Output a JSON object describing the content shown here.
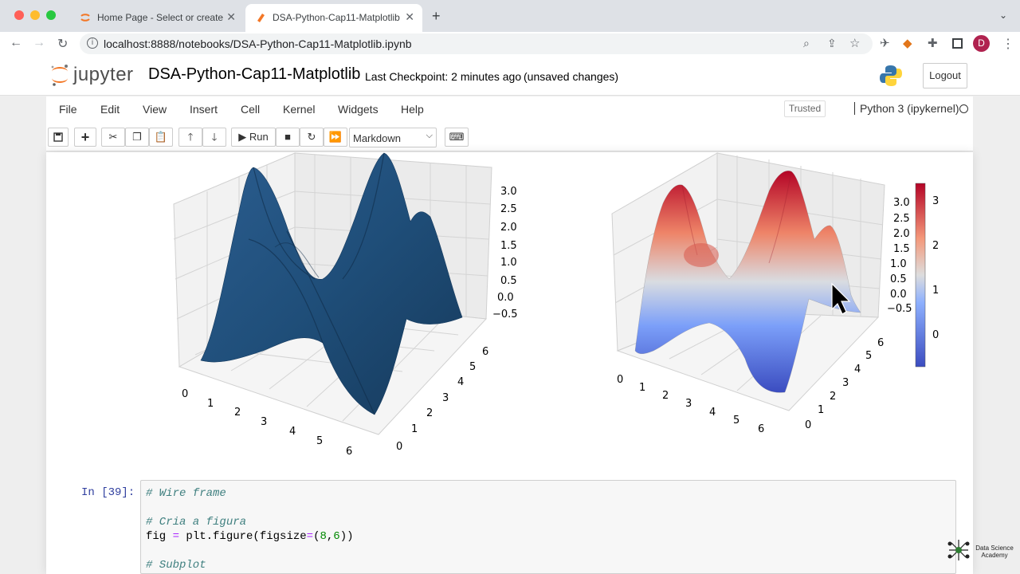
{
  "browser": {
    "tabs": [
      {
        "label": "Home Page - Select or create a notebook"
      },
      {
        "label": "DSA-Python-Cap11-Matplotlib"
      }
    ],
    "url": "localhost:8888/notebooks/DSA-Python-Cap11-Matplotlib.ipynb",
    "profile_initial": "D"
  },
  "jupyter": {
    "logo_text": "jupyter",
    "notebook_name": "DSA-Python-Cap11-Matplotlib",
    "checkpoint": "Last Checkpoint: 2 minutes ago",
    "status": "(unsaved changes)",
    "logout_label": "Logout",
    "menu": [
      "File",
      "Edit",
      "View",
      "Insert",
      "Cell",
      "Kernel",
      "Widgets",
      "Help"
    ],
    "trusted_label": "Trusted",
    "kernel_name": "Python 3 (ipykernel)",
    "toolbar": {
      "run_label": "Run",
      "cell_type": "Markdown"
    }
  },
  "chart_data": [
    {
      "type": "surface3d",
      "z_ticks": [
        "3.0",
        "2.5",
        "2.0",
        "1.5",
        "1.0",
        "0.5",
        "0.0",
        "−0.5"
      ],
      "x_ticks": [
        "0",
        "1",
        "2",
        "3",
        "4",
        "5",
        "6"
      ],
      "y_ticks": [
        "0",
        "1",
        "2",
        "3",
        "4",
        "5",
        "6"
      ],
      "colors": {
        "surface": "#1f4e79"
      }
    },
    {
      "type": "surface3d",
      "colormap": "coolwarm",
      "z_ticks": [
        "3.0",
        "2.5",
        "2.0",
        "1.5",
        "1.0",
        "0.5",
        "0.0",
        "−0.5"
      ],
      "x_ticks": [
        "0",
        "1",
        "2",
        "3",
        "4",
        "5",
        "6"
      ],
      "y_ticks": [
        "0",
        "1",
        "2",
        "3",
        "4",
        "5",
        "6"
      ],
      "colorbar_ticks": [
        "3",
        "2",
        "1",
        "0"
      ]
    }
  ],
  "code_cell": {
    "prompt": "In [39]:",
    "lines": [
      {
        "kind": "comment",
        "text": "# Wire frame"
      },
      {
        "kind": "blank",
        "text": ""
      },
      {
        "kind": "comment",
        "text": "# Cria a figura"
      },
      {
        "kind": "code",
        "text": "fig = plt.figure(figsize=(8,6))"
      },
      {
        "kind": "blank",
        "text": ""
      },
      {
        "kind": "comment",
        "text": "# Subplot"
      }
    ]
  },
  "watermark": {
    "line1": "Data Science",
    "line2": "Academy"
  }
}
